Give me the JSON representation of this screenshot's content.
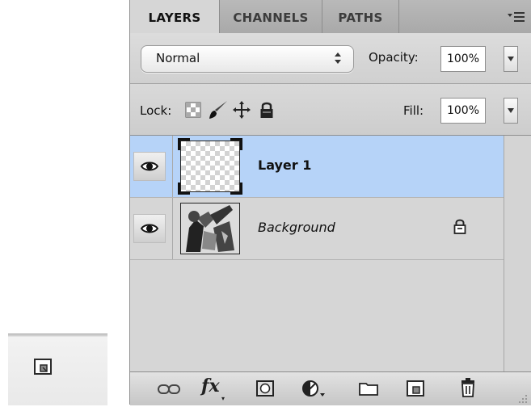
{
  "tabs": [
    {
      "label": "LAYERS",
      "active": true
    },
    {
      "label": "CHANNELS",
      "active": false
    },
    {
      "label": "PATHS",
      "active": false
    }
  ],
  "blend": {
    "mode": "Normal"
  },
  "opacity": {
    "label": "Opacity:",
    "value": "100%"
  },
  "lock": {
    "label": "Lock:"
  },
  "fill": {
    "label": "Fill:",
    "value": "100%"
  },
  "layers": [
    {
      "name": "Layer 1",
      "selected": true,
      "visible": true,
      "locked": false
    },
    {
      "name": "Background",
      "selected": false,
      "visible": true,
      "locked": true
    }
  ],
  "footer_icons": [
    "link-layers-icon",
    "fx-icon",
    "mask-icon",
    "adjustment-layer-icon",
    "folder-icon",
    "new-layer-icon",
    "trash-icon"
  ],
  "footer": {
    "fx_label": "fx"
  },
  "colors": {
    "selected_row": "#b6d3f8",
    "panel_bg": "#d6d6d6",
    "tab_bar": "#adadad"
  }
}
